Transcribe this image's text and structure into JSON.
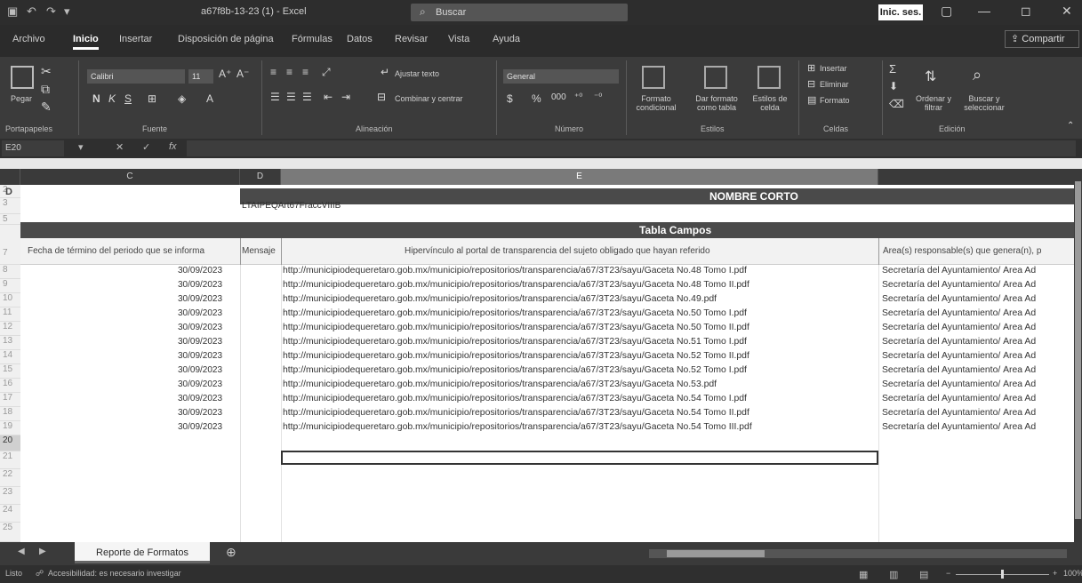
{
  "window": {
    "title": "a67f8b-13-23 (1) - Excel",
    "search_label": "Buscar",
    "signin_label": "Inic. ses.",
    "share_label": "Compartir"
  },
  "tabs": [
    {
      "label": "Archivo"
    },
    {
      "label": "Inicio"
    },
    {
      "label": "Insertar"
    },
    {
      "label": "Disposición de página"
    },
    {
      "label": "Fórmulas"
    },
    {
      "label": "Datos"
    },
    {
      "label": "Revisar"
    },
    {
      "label": "Vista"
    },
    {
      "label": "Ayuda"
    }
  ],
  "ribbon": {
    "groups": [
      "Portapapeles",
      "Fuente",
      "Alineación",
      "Número",
      "Estilos",
      "Celdas",
      "Edición"
    ],
    "paste_label": "Pegar",
    "font_name": "Calibri",
    "font_size": "11",
    "wrap_text": "Ajustar texto",
    "merge_center": "Combinar y centrar",
    "number_format": "General",
    "cond_format": "Formato condicional",
    "format_table": "Dar formato como tabla",
    "cell_styles": "Estilos de celda",
    "insert": "Insertar",
    "delete": "Eliminar",
    "format": "Formato",
    "sort_filter": "Ordenar y filtrar",
    "find_select": "Buscar y seleccionar"
  },
  "formula_bar": {
    "name_box": "E20",
    "fx": "fx"
  },
  "columns": [
    "C",
    "D",
    "E"
  ],
  "rows": [
    "2",
    "3",
    "5",
    "7",
    "8",
    "9",
    "10",
    "11",
    "12",
    "13",
    "14",
    "15",
    "16",
    "17",
    "18",
    "19",
    "20",
    "21",
    "22",
    "23",
    "24",
    "25"
  ],
  "sheet": {
    "row2_col_b": "D",
    "nombre_corto_label": "NOMBRE CORTO",
    "nombre_corto_value": "LTAIPEQArt67FraccVIIIB",
    "tabla_campos": "Tabla Campos",
    "headers": [
      "Fecha de término del periodo que se informa",
      "Mensaje",
      "Hipervínculo al portal de transparencia del sujeto obligado que hayan referido",
      "Área(s) responsable(s) que genera(n), p"
    ],
    "data_rows": [
      {
        "date": "30/09/2023",
        "url": "http://municipiodequeretaro.gob.mx/municipio/repositorios/transparencia/a67/3T23/sayu/Gaceta No.48 Tomo I.pdf",
        "area": "Secretaría del Ayuntamiento/ Área Ad"
      },
      {
        "date": "30/09/2023",
        "url": "http://municipiodequeretaro.gob.mx/municipio/repositorios/transparencia/a67/3T23/sayu/Gaceta No.48 Tomo II.pdf",
        "area": "Secretaría del Ayuntamiento/ Área Ad"
      },
      {
        "date": "30/09/2023",
        "url": "http://municipiodequeretaro.gob.mx/municipio/repositorios/transparencia/a67/3T23/sayu/Gaceta No.49.pdf",
        "area": "Secretaría del Ayuntamiento/ Área Ad"
      },
      {
        "date": "30/09/2023",
        "url": "http://municipiodequeretaro.gob.mx/municipio/repositorios/transparencia/a67/3T23/sayu/Gaceta No.50 Tomo I.pdf",
        "area": "Secretaría del Ayuntamiento/ Área Ad"
      },
      {
        "date": "30/09/2023",
        "url": "http://municipiodequeretaro.gob.mx/municipio/repositorios/transparencia/a67/3T23/sayu/Gaceta No.50 Tomo II.pdf",
        "area": "Secretaría del Ayuntamiento/ Área Ad"
      },
      {
        "date": "30/09/2023",
        "url": "http://municipiodequeretaro.gob.mx/municipio/repositorios/transparencia/a67/3T23/sayu/Gaceta No.51 Tomo I.pdf",
        "area": "Secretaría del Ayuntamiento/ Área Ad"
      },
      {
        "date": "30/09/2023",
        "url": "http://municipiodequeretaro.gob.mx/municipio/repositorios/transparencia/a67/3T23/sayu/Gaceta No.52 Tomo II.pdf",
        "area": "Secretaría del Ayuntamiento/ Área Ad"
      },
      {
        "date": "30/09/2023",
        "url": "http://municipiodequeretaro.gob.mx/municipio/repositorios/transparencia/a67/3T23/sayu/Gaceta No.52 Tomo I.pdf",
        "area": "Secretaría del Ayuntamiento/ Área Ad"
      },
      {
        "date": "30/09/2023",
        "url": "http://municipiodequeretaro.gob.mx/municipio/repositorios/transparencia/a67/3T23/sayu/Gaceta No.53.pdf",
        "area": "Secretaría del Ayuntamiento/ Área Ad"
      },
      {
        "date": "30/09/2023",
        "url": "http://municipiodequeretaro.gob.mx/municipio/repositorios/transparencia/a67/3T23/sayu/Gaceta No.54 Tomo I.pdf",
        "area": "Secretaría del Ayuntamiento/ Área Ad"
      },
      {
        "date": "30/09/2023",
        "url": "http://municipiodequeretaro.gob.mx/municipio/repositorios/transparencia/a67/3T23/sayu/Gaceta No.54 Tomo II.pdf",
        "area": "Secretaría del Ayuntamiento/ Área Ad"
      },
      {
        "date": "30/09/2023",
        "url": "http://municipiodequeretaro.gob.mx/municipio/repositorios/transparencia/a67/3T23/sayu/Gaceta No.54 Tomo III.pdf",
        "area": "Secretaría del Ayuntamiento/ Área Ad"
      }
    ]
  },
  "sheet_tab": "Reporte de Formatos",
  "status": {
    "ready": "Listo",
    "accessibility": "Accesibilidad: es necesario investigar",
    "zoom": "100%"
  },
  "colors": {
    "band": "#4a4a4a",
    "ribbon": "#3b3b3b"
  }
}
